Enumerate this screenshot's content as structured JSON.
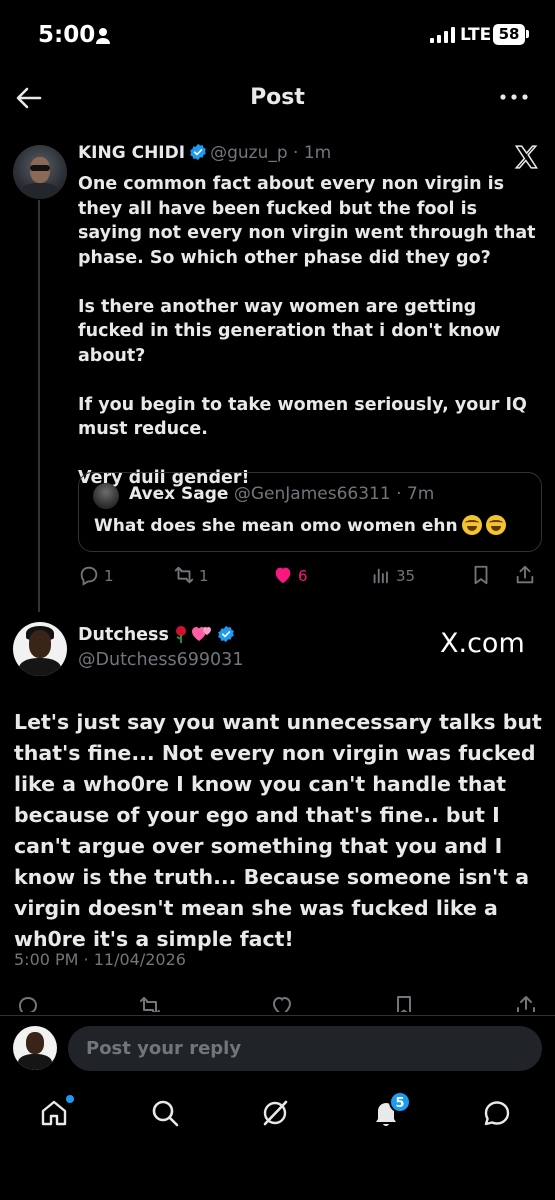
{
  "status_bar": {
    "time": "5:00",
    "network": "LTE",
    "battery": "58"
  },
  "header": {
    "title": "Post"
  },
  "quoted_thread": {
    "author_name": "KING CHIDI",
    "handle": "@guzu_p",
    "age": "· 1m",
    "paragraphs": [
      "One common fact about every non virgin is they all have been fucked but the fool is saying not every non virgin went through that phase. So which other phase did they go?",
      "Is there another way women are getting fucked in this generation that i don't know about?",
      "If you begin to take women seriously, your IQ must reduce.",
      "Very dull gender!"
    ],
    "quote": {
      "author_name": "Avex Sage",
      "handle": "@GenJames66311",
      "age": "· 7m",
      "text": "What does she mean omo women ehn"
    },
    "actions": {
      "replies": "1",
      "reposts": "1",
      "likes": "6",
      "views": "35"
    }
  },
  "main_post": {
    "author_name": "Dutchess",
    "handle": "@Dutchess699031",
    "watermark": "X.com",
    "text": "Let's just say you want unnecessary talks but that's fine... Not every non virgin was fucked like a who0re I know you can't handle that because of your ego and that's fine.. but I can't argue over something that you and I know is the truth... Because someone isn't a virgin doesn't mean she was fucked like a wh0re it's a simple fact!",
    "timestamp": "5:00 PM · 11/04/2026"
  },
  "reply_bar": {
    "placeholder": "Post your reply"
  },
  "bottom_nav": {
    "notifications_badge": "5"
  },
  "colors": {
    "background": "#000000",
    "accent": "#1d9bf0",
    "like": "#f91880",
    "muted_text": "#71767b"
  }
}
